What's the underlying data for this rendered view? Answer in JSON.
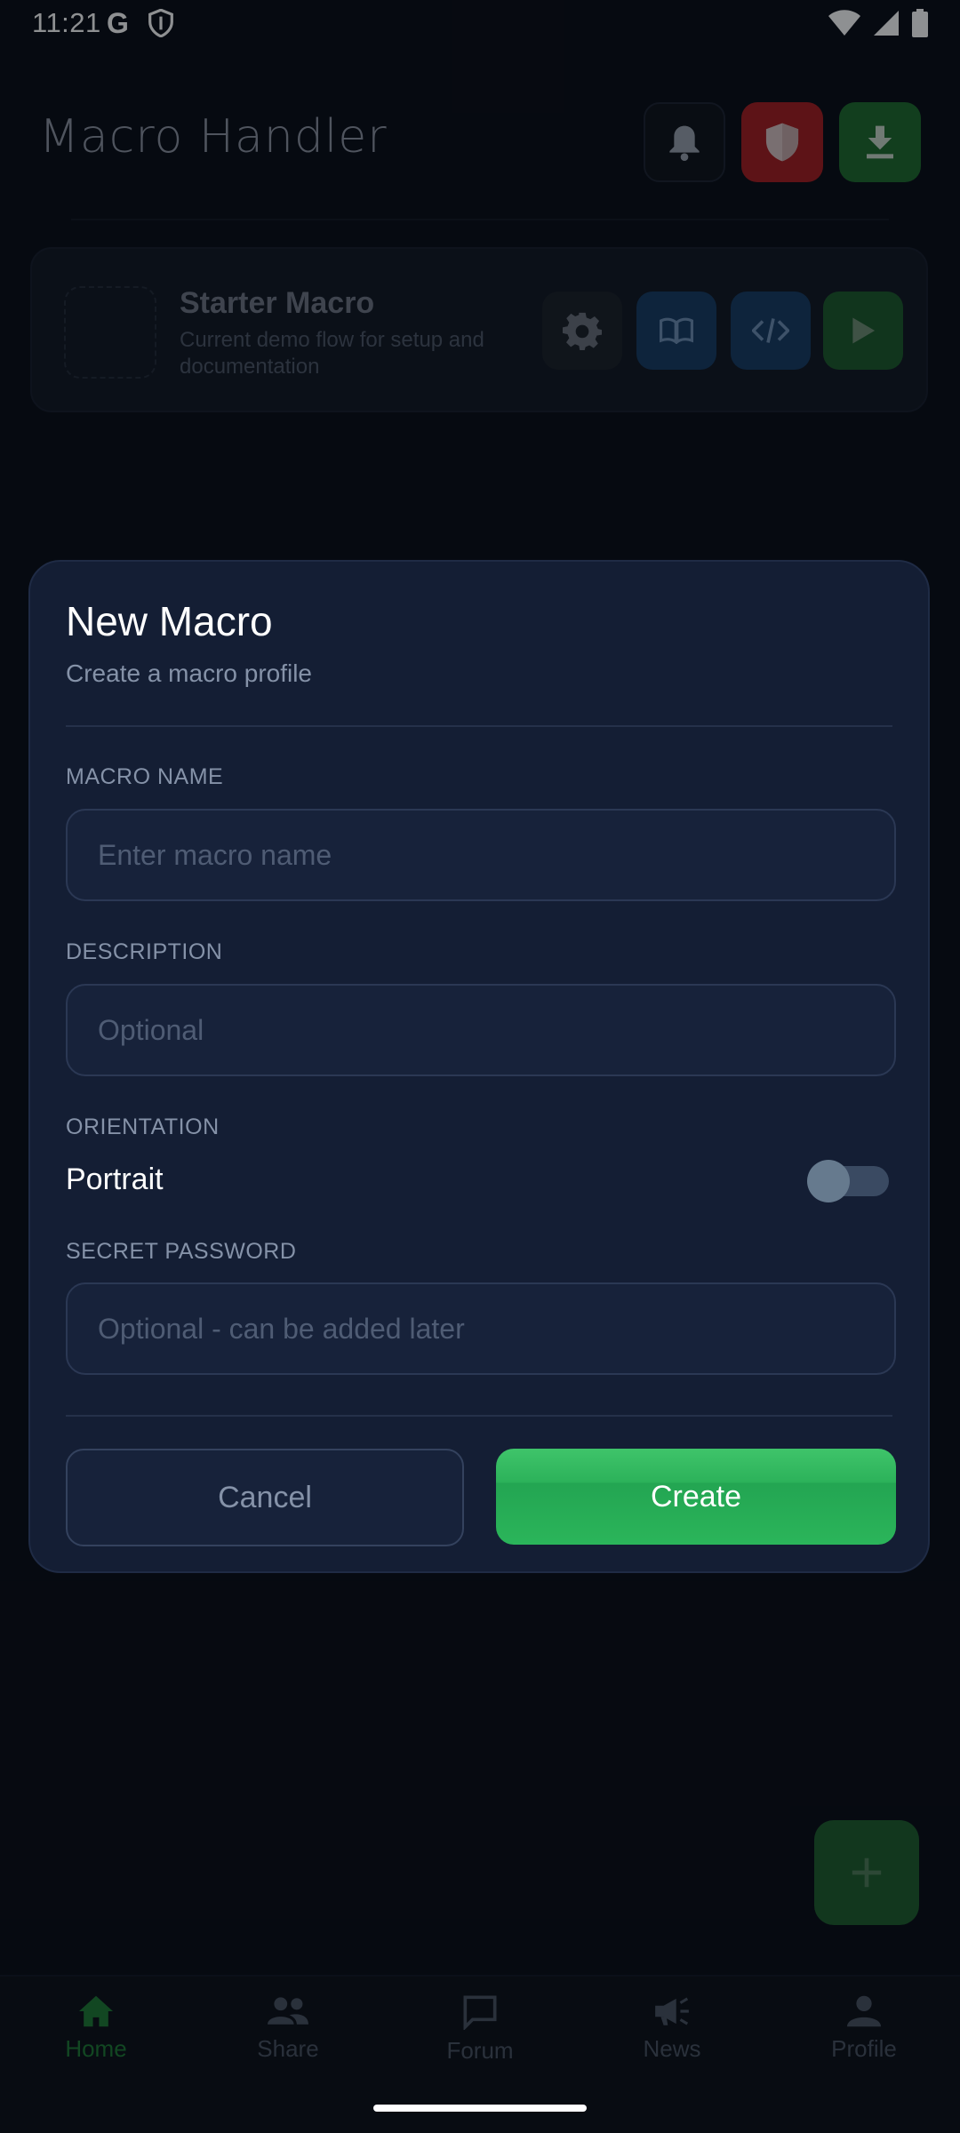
{
  "status_bar": {
    "time": "11:21",
    "google_glyph": "G"
  },
  "header": {
    "title": "Macro Handler",
    "buttons": [
      {
        "icon": "bell-icon",
        "color": "#0d1118"
      },
      {
        "icon": "shield-icon",
        "color": "#a61d1f"
      },
      {
        "icon": "download-icon",
        "color": "#1e6b2c"
      }
    ]
  },
  "macro_card": {
    "name": "Starter Macro",
    "description": "Current demo flow for setup and documentation",
    "actions": [
      "gear-icon",
      "book-icon",
      "code-icon",
      "play-icon"
    ]
  },
  "dialog": {
    "title": "New Macro",
    "subtitle": "Create a macro profile",
    "name_label": "MACRO NAME",
    "name_placeholder": "Enter macro name",
    "name_value": "",
    "description_label": "DESCRIPTION",
    "description_placeholder": "Optional",
    "description_value": "",
    "orientation_label": "ORIENTATION",
    "orientation_value": "Portrait",
    "orientation_toggle_on": false,
    "password_label": "SECRET PASSWORD",
    "password_placeholder": "Optional - can be added later",
    "password_value": "",
    "cancel_label": "Cancel",
    "create_label": "Create",
    "accent_color": "#2cb25a"
  },
  "fab": {
    "icon": "plus-icon"
  },
  "nav": {
    "items": [
      {
        "label": "Home",
        "icon": "home-icon",
        "active": true
      },
      {
        "label": "Share",
        "icon": "people-icon",
        "active": false
      },
      {
        "label": "Forum",
        "icon": "chat-icon",
        "active": false
      },
      {
        "label": "News",
        "icon": "megaphone-icon",
        "active": false
      },
      {
        "label": "Profile",
        "icon": "person-icon",
        "active": false
      }
    ]
  }
}
